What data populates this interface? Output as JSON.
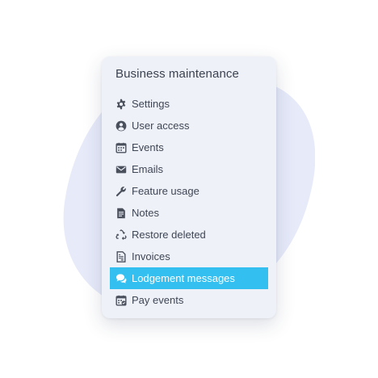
{
  "panel": {
    "title": "Business maintenance"
  },
  "menu": {
    "items": [
      {
        "label": "Settings",
        "icon": "gear-icon"
      },
      {
        "label": "User access",
        "icon": "user-icon"
      },
      {
        "label": "Events",
        "icon": "calendar-icon"
      },
      {
        "label": "Emails",
        "icon": "envelope-icon"
      },
      {
        "label": "Feature usage",
        "icon": "wrench-icon"
      },
      {
        "label": "Notes",
        "icon": "document-icon"
      },
      {
        "label": "Restore deleted",
        "icon": "recycle-icon"
      },
      {
        "label": "Invoices",
        "icon": "invoice-icon"
      },
      {
        "label": "Lodgement messages",
        "icon": "chat-icon",
        "active": true
      },
      {
        "label": "Pay events",
        "icon": "calendar-check-icon"
      }
    ]
  },
  "colors": {
    "panel_background": "#eef1f8",
    "active_item": "#33bff0",
    "text": "#3f4654",
    "background_shape": "#e6eaf9"
  }
}
